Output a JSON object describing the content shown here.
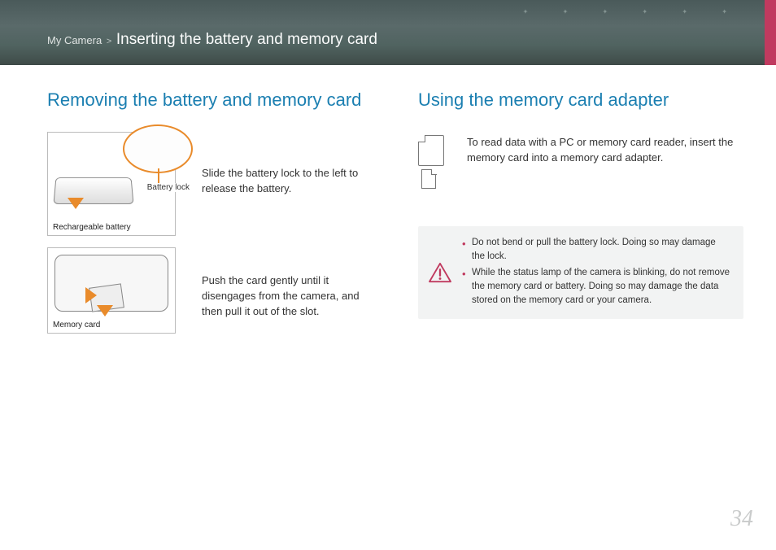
{
  "header": {
    "breadcrumb_category": "My Camera",
    "breadcrumb_section": "Inserting the battery and memory card"
  },
  "left": {
    "title": "Removing the battery and memory card",
    "fig1": {
      "callout_label": "Battery lock",
      "caption": "Rechargeable battery",
      "desc": "Slide the battery lock to the left to release the battery."
    },
    "fig2": {
      "caption": "Memory card",
      "desc": "Push the card gently until it disengages from the camera, and then pull it out of the slot."
    }
  },
  "right": {
    "title": "Using the memory card adapter",
    "adapter_desc": "To read data with a PC or memory card reader, insert the memory card into a memory card adapter.",
    "warnings": [
      "Do not bend or pull the battery lock. Doing so may damage the lock.",
      "While the status lamp of the camera is blinking, do not remove the memory card or battery. Doing so may damage the data stored on the memory card or your camera."
    ]
  },
  "page_number": "34"
}
